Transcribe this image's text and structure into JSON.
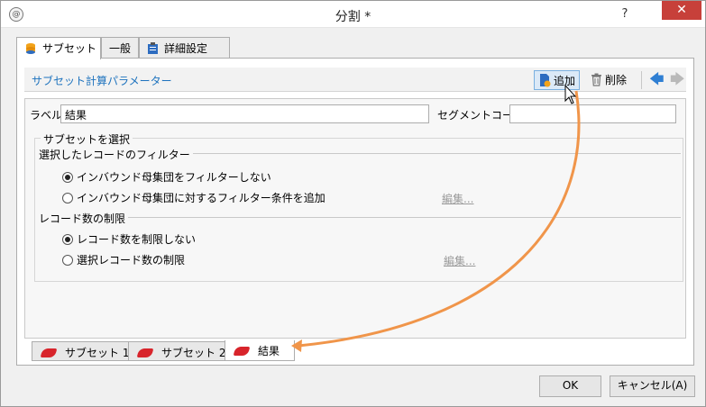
{
  "window": {
    "title": "分割 *",
    "help": "?",
    "close": "✕",
    "app_icon": "@"
  },
  "tabs": [
    {
      "label": "サブセット",
      "icon": "database-icon"
    },
    {
      "label": "一般"
    },
    {
      "label": "詳細設定",
      "icon": "clipboard-icon"
    }
  ],
  "section": {
    "title": "サブセット計算パラメーター"
  },
  "toolbar": {
    "add_label": "追加",
    "delete_label": "削除"
  },
  "form": {
    "label_caption": "ラベル:",
    "label_value": "結果",
    "segment_caption": "セグメントコード:",
    "segment_value": ""
  },
  "subset_group": {
    "legend": "サブセットを選択",
    "filter_heading": "選択したレコードのフィルター",
    "filter_options": [
      {
        "label": "インバウンド母集団をフィルターしない",
        "selected": true
      },
      {
        "label": "インバウンド母集団に対するフィルター条件を追加",
        "selected": false
      }
    ],
    "filter_edit": "編集...",
    "limit_heading": "レコード数の制限",
    "limit_options": [
      {
        "label": "レコード数を制限しない",
        "selected": true
      },
      {
        "label": "選択レコード数の制限",
        "selected": false
      }
    ],
    "limit_edit": "編集..."
  },
  "subtabs": [
    {
      "label": "サブセット 1"
    },
    {
      "label": "サブセット 2"
    },
    {
      "label": "結果",
      "active": true
    }
  ],
  "buttons": {
    "ok": "OK",
    "cancel": "キャンセル(A)"
  },
  "colors": {
    "accent": "#1e73be",
    "close": "#c7403a",
    "segment": "#d8242b",
    "annotation_arrow": "#f0954a"
  }
}
